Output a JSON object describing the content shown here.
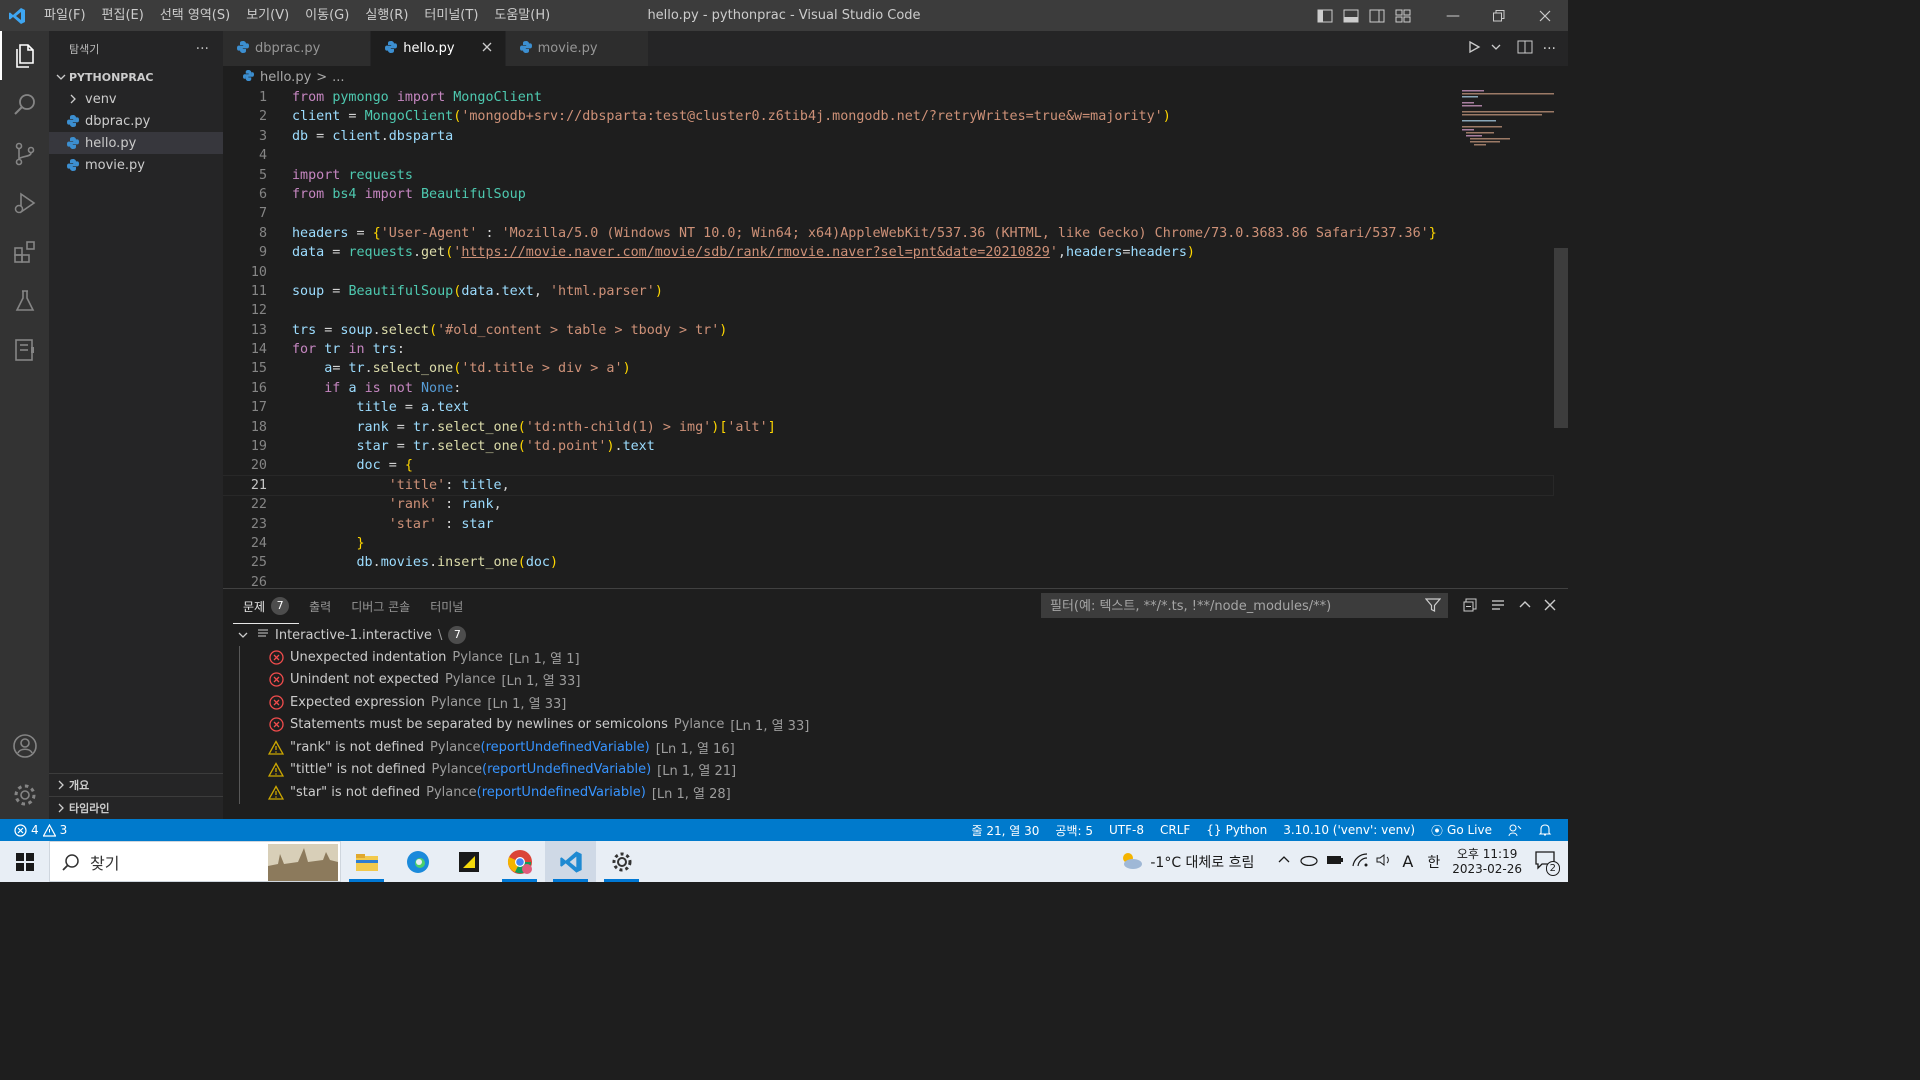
{
  "window": {
    "title": "hello.py - pythonprac - Visual Studio Code",
    "menu": [
      "파일(F)",
      "편집(E)",
      "선택 영역(S)",
      "보기(V)",
      "이동(G)",
      "실행(R)",
      "터미널(T)",
      "도움말(H)"
    ],
    "accent": "#007acc"
  },
  "sidebar": {
    "title": "탐색기",
    "more": "···",
    "folder": "PYTHONPRAC",
    "items": [
      {
        "label": "venv",
        "type": "folder"
      },
      {
        "label": "dbprac.py",
        "type": "python"
      },
      {
        "label": "hello.py",
        "type": "python",
        "selected": true
      },
      {
        "label": "movie.py",
        "type": "python"
      }
    ],
    "outline": "개요",
    "timeline": "타임라인"
  },
  "tabs": [
    {
      "label": "dbprac.py",
      "active": false
    },
    {
      "label": "hello.py",
      "active": true
    },
    {
      "label": "movie.py",
      "active": false
    }
  ],
  "breadcrumb": {
    "file": "hello.py",
    "sep": ">",
    "rest": "..."
  },
  "editor": {
    "current_line": 21,
    "lines": [
      "from pymongo import MongoClient",
      "client = MongoClient('mongodb+srv://dbsparta:test@cluster0.z6tib4j.mongodb.net/?retryWrites=true&w=majority')",
      "db = client.dbsparta",
      "",
      "import requests",
      "from bs4 import BeautifulSoup",
      "",
      "headers = {'User-Agent' : 'Mozilla/5.0 (Windows NT 10.0; Win64; x64)AppleWebKit/537.36 (KHTML, like Gecko) Chrome/73.0.3683.86 Safari/537.36'}",
      "data = requests.get('https://movie.naver.com/movie/sdb/rank/rmovie.naver?sel=pnt&date=20210829',headers=headers)",
      "",
      "soup = BeautifulSoup(data.text, 'html.parser')",
      "",
      "trs = soup.select('#old_content > table > tbody > tr')",
      "for tr in trs:",
      "    a= tr.select_one('td.title > div > a')",
      "    if a is not None:",
      "        title = a.text",
      "        rank = tr.select_one('td:nth-child(1) > img')['alt']",
      "        star = tr.select_one('td.point').text",
      "        doc = {",
      "            'title': title,",
      "            'rank' : rank,",
      "            'star' : star",
      "        }",
      "        db.movies.insert_one(doc)",
      ""
    ]
  },
  "panel": {
    "tabs": [
      {
        "label": "문제",
        "badge": "7",
        "active": true
      },
      {
        "label": "출력"
      },
      {
        "label": "디버그 콘솔"
      },
      {
        "label": "터미널"
      }
    ],
    "filter_placeholder": "필터(예: 텍스트, **/*.ts, !**/node_modules/**)",
    "group": {
      "label": "Interactive-1.interactive",
      "sep": "\\",
      "count": "7"
    },
    "problems": [
      {
        "severity": "error",
        "message": "Unexpected indentation",
        "source": "Pylance",
        "code": "",
        "position": "[Ln 1, 열 1]"
      },
      {
        "severity": "error",
        "message": "Unindent not expected",
        "source": "Pylance",
        "code": "",
        "position": "[Ln 1, 열 33]"
      },
      {
        "severity": "error",
        "message": "Expected expression",
        "source": "Pylance",
        "code": "",
        "position": "[Ln 1, 열 33]"
      },
      {
        "severity": "error",
        "message": "Statements must be separated by newlines or semicolons",
        "source": "Pylance",
        "code": "",
        "position": "[Ln 1, 열 33]"
      },
      {
        "severity": "warning",
        "message": "\"rank\" is not defined",
        "source": "Pylance",
        "code": "reportUndefinedVariable",
        "position": "[Ln 1, 열 16]"
      },
      {
        "severity": "warning",
        "message": "\"tittle\" is not defined",
        "source": "Pylance",
        "code": "reportUndefinedVariable",
        "position": "[Ln 1, 열 21]"
      },
      {
        "severity": "warning",
        "message": "\"star\" is not defined",
        "source": "Pylance",
        "code": "reportUndefinedVariable",
        "position": "[Ln 1, 열 28]"
      }
    ]
  },
  "statusbar": {
    "errors": "4",
    "warnings": "3",
    "position": "줄 21, 열 30",
    "spaces": "공백: 5",
    "encoding": "UTF-8",
    "eol": "CRLF",
    "language": "Python",
    "interpreter": "3.10.10 ('venv': venv)",
    "golive": "Go Live"
  },
  "taskbar": {
    "search": "찾기",
    "weather": "-1°C 대체로 흐림",
    "ime_a": "A",
    "ime_lang": "한",
    "time": "오후 11:19",
    "date": "2023-02-26",
    "notifications": "2"
  }
}
